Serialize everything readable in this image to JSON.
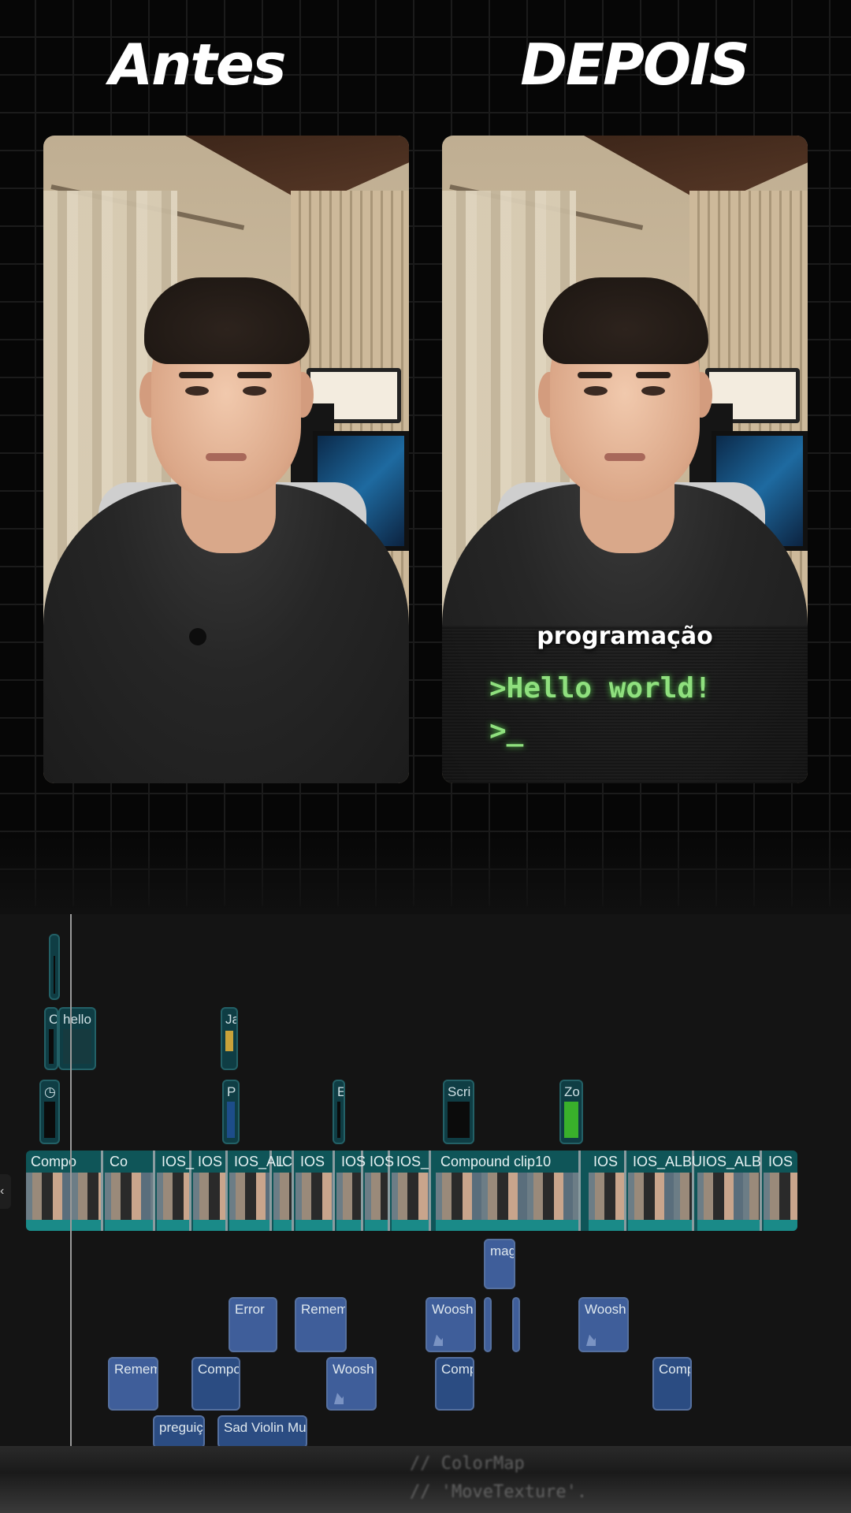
{
  "headings": {
    "before": "Antes",
    "after": "DEPOIS"
  },
  "video_after": {
    "caption": "programação",
    "terminal_line1": ">Hello world!",
    "terminal_line2": ">_"
  },
  "timeline": {
    "title_clips": [
      {
        "label": "C"
      },
      {
        "label": "hello"
      },
      {
        "label": "Ja"
      },
      {
        "label": ""
      },
      {
        "label": "P"
      },
      {
        "label": "E"
      },
      {
        "label": "Scri"
      },
      {
        "label": "Zo"
      }
    ],
    "main_segments": [
      {
        "label": "Compo"
      },
      {
        "label": "Co"
      },
      {
        "label": "IOS_"
      },
      {
        "label": "IOS"
      },
      {
        "label": "IOS_AL"
      },
      {
        "label": "IC"
      },
      {
        "label": "IOS"
      },
      {
        "label": "IOS"
      },
      {
        "label": "IOS"
      },
      {
        "label": "IOS_"
      },
      {
        "label": "Compound clip10"
      },
      {
        "label": "IOS"
      },
      {
        "label": "IOS_ALBU"
      },
      {
        "label": "IOS_ALB"
      },
      {
        "label": "IOS"
      }
    ],
    "audio_clips": [
      {
        "label": "mag"
      },
      {
        "label": "Error"
      },
      {
        "label": "Remem"
      },
      {
        "label": "Woosh"
      },
      {
        "label": "Woosh"
      },
      {
        "label": "Remem"
      },
      {
        "label": "Compo"
      },
      {
        "label": "Woosh"
      },
      {
        "label": "Comp"
      },
      {
        "label": "Comp"
      },
      {
        "label": "preguiç"
      },
      {
        "label": "Sad Violin Mu"
      }
    ]
  },
  "background_text": {
    "line1": "// ColorMap",
    "line2": "// 'MoveTexture'."
  }
}
